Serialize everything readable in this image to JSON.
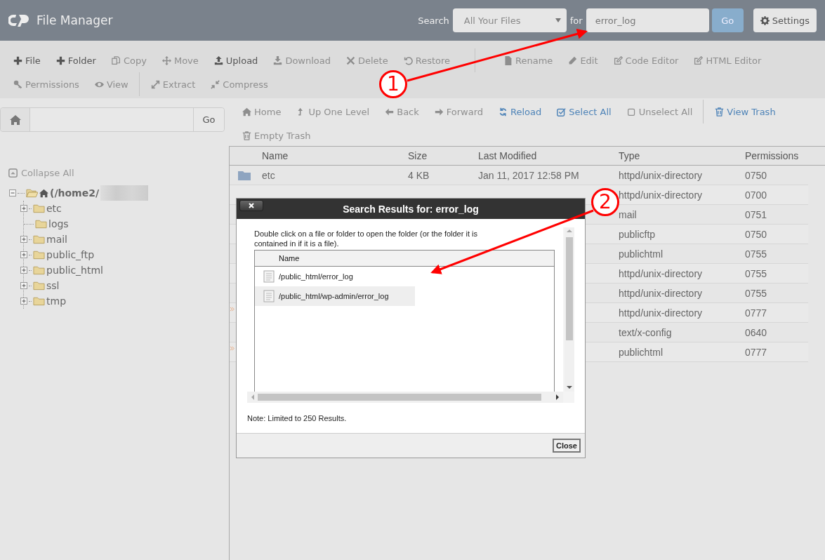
{
  "header": {
    "title": "File Manager",
    "search_label": "Search",
    "scope": "All Your Files",
    "for_label": "for",
    "query": "error_log",
    "go": "Go",
    "settings": "Settings"
  },
  "toolbar": {
    "items": [
      {
        "label": "File",
        "kind": "plus",
        "disabled": false,
        "divider_before": false
      },
      {
        "label": "Folder",
        "kind": "plus",
        "disabled": false,
        "divider_before": false
      },
      {
        "label": "Copy",
        "kind": "copy",
        "disabled": true,
        "divider_before": false
      },
      {
        "label": "Move",
        "kind": "move",
        "disabled": true,
        "divider_before": false
      },
      {
        "label": "Upload",
        "kind": "upload",
        "disabled": false,
        "divider_before": false
      },
      {
        "label": "Download",
        "kind": "download",
        "disabled": true,
        "divider_before": false
      },
      {
        "label": "Delete",
        "kind": "delete",
        "disabled": true,
        "divider_before": false
      },
      {
        "label": "Restore",
        "kind": "restore",
        "disabled": true,
        "divider_before": false
      },
      {
        "label": "Rename",
        "kind": "file",
        "disabled": true,
        "divider_before": true
      },
      {
        "label": "Edit",
        "kind": "pencil",
        "disabled": true,
        "divider_before": false
      },
      {
        "label": "Code Editor",
        "kind": "editor",
        "disabled": true,
        "divider_before": false
      },
      {
        "label": "HTML Editor",
        "kind": "editor",
        "disabled": true,
        "divider_before": false
      },
      {
        "label": "Permissions",
        "kind": "key",
        "disabled": true,
        "divider_before": false
      },
      {
        "label": "View",
        "kind": "eye",
        "disabled": true,
        "divider_before": false
      },
      {
        "label": "Extract",
        "kind": "expand",
        "disabled": true,
        "divider_before": true
      },
      {
        "label": "Compress",
        "kind": "compress",
        "disabled": true,
        "divider_before": false
      }
    ]
  },
  "path_bar": {
    "go": "Go"
  },
  "tree": {
    "collapse_all": "Collapse All",
    "root": {
      "label": "(/home2/",
      "expanded": true,
      "children": [
        {
          "label": "etc",
          "kind": "collapsed"
        },
        {
          "label": "logs",
          "kind": "leaf"
        },
        {
          "label": "mail",
          "kind": "collapsed"
        },
        {
          "label": "public_ftp",
          "kind": "collapsed"
        },
        {
          "label": "public_html",
          "kind": "collapsed"
        },
        {
          "label": "ssl",
          "kind": "collapsed"
        },
        {
          "label": "tmp",
          "kind": "collapsed"
        }
      ]
    }
  },
  "nav": {
    "items": [
      {
        "label": "Home",
        "kind": "home",
        "disabled": true,
        "divider_before": false
      },
      {
        "label": "Up One Level",
        "kind": "up",
        "disabled": true,
        "divider_before": false
      },
      {
        "label": "Back",
        "kind": "back",
        "disabled": true,
        "divider_before": false
      },
      {
        "label": "Forward",
        "kind": "forward",
        "disabled": true,
        "divider_before": false
      },
      {
        "label": "Reload",
        "kind": "reload",
        "disabled": false,
        "divider_before": false
      },
      {
        "label": "Select All",
        "kind": "check",
        "disabled": false,
        "divider_before": false
      },
      {
        "label": "Unselect All",
        "kind": "box",
        "disabled": true,
        "divider_before": false
      },
      {
        "label": "View Trash",
        "kind": "trash",
        "disabled": false,
        "divider_before": true
      },
      {
        "label": "Empty Trash",
        "kind": "trash",
        "disabled": true,
        "divider_before": false
      }
    ]
  },
  "table": {
    "columns": [
      "Name",
      "Size",
      "Last Modified",
      "Type",
      "Permissions"
    ],
    "rows": [
      {
        "name": "etc",
        "size": "4 KB",
        "last_modified": "Jan 11, 2017 12:58 PM",
        "type": "httpd/unix-directory",
        "permissions": "0750",
        "marked": false
      },
      {
        "type": "httpd/unix-directory",
        "permissions": "0700",
        "marked": false
      },
      {
        "type": "mail",
        "permissions": "0751",
        "marked": false
      },
      {
        "type": "publicftp",
        "permissions": "0750",
        "marked": false
      },
      {
        "type": "publichtml",
        "permissions": "0755",
        "marked": false
      },
      {
        "type": "httpd/unix-directory",
        "permissions": "0755",
        "marked": false
      },
      {
        "type": "httpd/unix-directory",
        "permissions": "0755",
        "marked": false
      },
      {
        "type": "httpd/unix-directory",
        "permissions": "0777",
        "marked": true
      },
      {
        "type": "text/x-config",
        "permissions": "0640",
        "marked": false
      },
      {
        "type": "publichtml",
        "permissions": "0777",
        "marked": true
      }
    ]
  },
  "dialog": {
    "title": "Search Results for: error_log",
    "instructions": "Double click on a file or folder to open the folder (or the folder it is contained in if it is a file).",
    "column": "Name",
    "results": [
      {
        "path": "/public_html/error_log",
        "selected": false
      },
      {
        "path": "/public_html/wp-admin/error_log",
        "selected": true
      }
    ],
    "note": "Note: Limited to 250 Results.",
    "close": "Close"
  },
  "callouts": [
    {
      "number": "1"
    },
    {
      "number": "2"
    }
  ]
}
